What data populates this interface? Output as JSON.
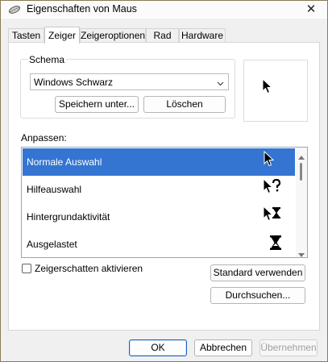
{
  "window": {
    "title": "Eigenschaften von Maus",
    "close_glyph": "✕"
  },
  "tabs": [
    {
      "label": "Tasten",
      "active": false
    },
    {
      "label": "Zeiger",
      "active": true
    },
    {
      "label": "Zeigeroptionen",
      "active": false
    },
    {
      "label": "Rad",
      "active": false
    },
    {
      "label": "Hardware",
      "active": false
    }
  ],
  "schema": {
    "legend": "Schema",
    "selected": "Windows Schwarz",
    "save_as_label": "Speichern unter...",
    "delete_label": "Löschen"
  },
  "customize": {
    "label": "Anpassen:",
    "items": [
      {
        "name": "Normale Auswahl",
        "selected": true,
        "icon": "arrow-cursor-icon"
      },
      {
        "name": "Hilfeauswahl",
        "selected": false,
        "icon": "help-cursor-icon"
      },
      {
        "name": "Hintergrundaktivität",
        "selected": false,
        "icon": "working-in-background-cursor-icon"
      },
      {
        "name": "Ausgelastet",
        "selected": false,
        "icon": "busy-hourglass-cursor-icon"
      }
    ]
  },
  "options": {
    "shadow_label": "Zeigerschatten aktivieren",
    "shadow_checked": false,
    "use_default_label": "Standard verwenden",
    "browse_label": "Durchsuchen..."
  },
  "footer": {
    "ok_label": "OK",
    "cancel_label": "Abbrechen",
    "apply_label": "Übernehmen"
  },
  "colors": {
    "selection": "#3475d1",
    "primary_border": "#1a64c4"
  }
}
